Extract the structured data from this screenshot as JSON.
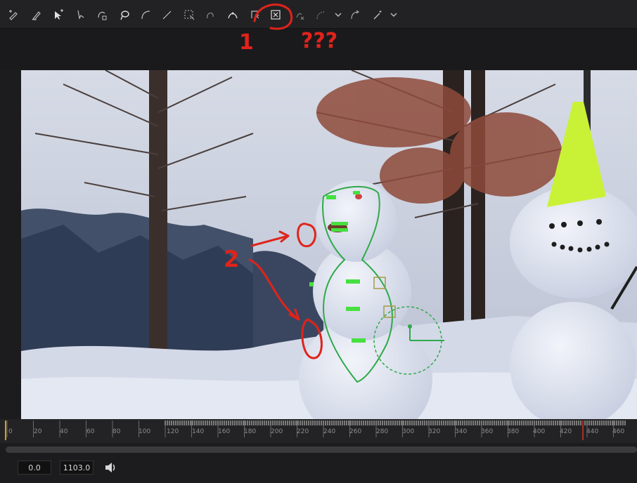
{
  "toolbar": {
    "tools": [
      {
        "icon": "add-point-pen-icon"
      },
      {
        "icon": "pencil-icon"
      },
      {
        "icon": "select-add-icon"
      },
      {
        "icon": "select-icon"
      },
      {
        "icon": "select-lock-icon"
      },
      {
        "icon": "lasso-icon"
      },
      {
        "icon": "curve-icon"
      },
      {
        "icon": "line-icon"
      },
      {
        "icon": "box-select-icon"
      },
      {
        "icon": "undo-curve-icon"
      },
      {
        "icon": "bezier-icon"
      },
      {
        "icon": "delete-point-icon"
      },
      {
        "icon": "close-shape-icon"
      },
      {
        "icon": "x-point-icon"
      },
      {
        "icon": "smooth-point-icon"
      },
      {
        "icon": "chevron-down-icon"
      },
      {
        "icon": "reverse-icon"
      },
      {
        "icon": "magic-wand-icon"
      },
      {
        "icon": "chevron-down-icon"
      }
    ]
  },
  "timeline": {
    "ticks": [
      "0",
      "20",
      "40",
      "60",
      "80",
      "100",
      "120",
      "140",
      "160",
      "180",
      "200",
      "220",
      "240",
      "260",
      "280",
      "300",
      "320",
      "340",
      "360",
      "380",
      "400",
      "420",
      "440",
      "460"
    ]
  },
  "footer": {
    "start_time": "0.0",
    "end_time": "1103.0",
    "speaker_icon": "speaker-icon"
  },
  "annotations": {
    "mark_1": "1",
    "mark_question": "???",
    "mark_2": "2"
  },
  "colors": {
    "annotation_red": "#e0231b",
    "spline_green": "#2fa94a",
    "hat_yellow": "#c9f236"
  }
}
